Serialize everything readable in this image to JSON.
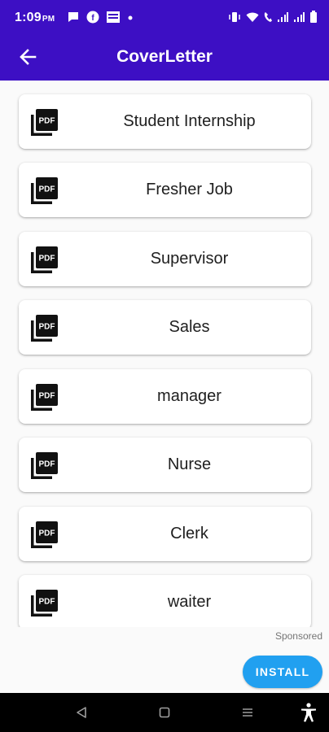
{
  "status_bar": {
    "time": "1:09",
    "ampm": "PM"
  },
  "app_bar": {
    "title": "CoverLetter",
    "back_icon": "arrow-left-icon"
  },
  "colors": {
    "primary": "#3d0fc4",
    "install_button": "#21a0f0",
    "background": "#fafafa"
  },
  "templates": [
    {
      "label": "Student Internship",
      "icon": "pdf-icon"
    },
    {
      "label": "Fresher Job",
      "icon": "pdf-icon"
    },
    {
      "label": "Supervisor",
      "icon": "pdf-icon"
    },
    {
      "label": "Sales",
      "icon": "pdf-icon"
    },
    {
      "label": "manager",
      "icon": "pdf-icon"
    },
    {
      "label": "Nurse",
      "icon": "pdf-icon"
    },
    {
      "label": "Clerk",
      "icon": "pdf-icon"
    },
    {
      "label": "waiter",
      "icon": "pdf-icon"
    }
  ],
  "ad": {
    "sponsored_label": "Sponsored",
    "install_label": "INSTALL"
  },
  "nav_bar": {
    "buttons": [
      "back-nav-icon",
      "home-nav-icon",
      "recents-nav-icon",
      "accessibility-icon"
    ]
  }
}
